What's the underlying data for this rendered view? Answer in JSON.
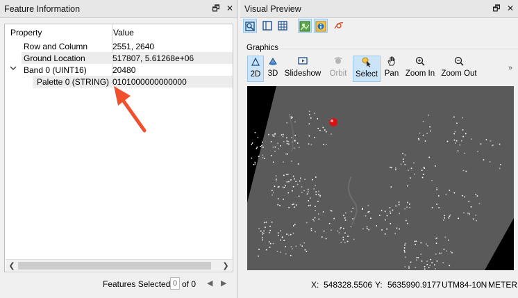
{
  "feature_panel": {
    "title": "Feature Information",
    "float_label": "🗗",
    "close_label": "✕",
    "columns": {
      "property": "Property",
      "value": "Value"
    },
    "rows": [
      {
        "property": "Row and Column",
        "value": "2551, 2640"
      },
      {
        "property": "Ground Location",
        "value": "517807, 5.61268e+06"
      },
      {
        "property": "Band 0 (UINT16)",
        "value": "20480"
      },
      {
        "property": "Palette 0 (STRING)",
        "value": "0101000000000000"
      }
    ],
    "features_selected_label": "Features Selected:",
    "features_selected_count": "0",
    "features_total": "of 0"
  },
  "preview_panel": {
    "title": "Visual Preview",
    "float_label": "🗗",
    "close_label": "✕",
    "graphics_label": "Graphics",
    "tools": [
      {
        "label": "2D"
      },
      {
        "label": "3D"
      },
      {
        "label": "Slideshow"
      },
      {
        "label": "Orbit"
      },
      {
        "label": "Select"
      },
      {
        "label": "Pan"
      },
      {
        "label": "Zoom In"
      },
      {
        "label": "Zoom Out"
      }
    ],
    "more_label": "»"
  },
  "status": {
    "x_label": "X:",
    "x_value": "548328.5506",
    "y_label": "Y:",
    "y_value": "5635990.9177",
    "crs": "UTM84-10N",
    "unit": "METER"
  },
  "icons": {
    "annotation_arrow": "arrow-annotation",
    "map_marker": "red-marker"
  },
  "colors": {
    "annotation_red": "#f0502d",
    "selection_blue": "#cce4f7",
    "map_gray": "#5a5a5a"
  }
}
